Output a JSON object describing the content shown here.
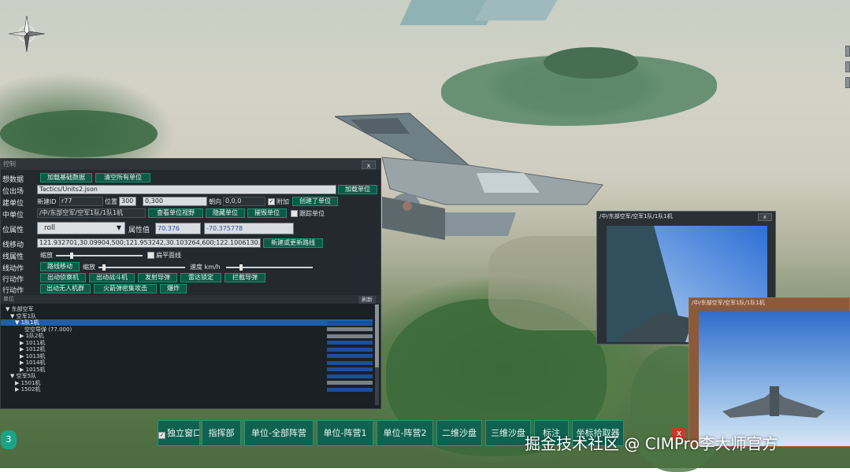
{
  "scene": {
    "compass_icon": "compass-rose-icon"
  },
  "main_panel": {
    "title": "控制",
    "close_label": "x",
    "rows": {
      "data": {
        "label": "想数据",
        "load_btn": "加载基础数据",
        "clear_btn": "清空所有单位"
      },
      "scene": {
        "label": "位出场",
        "path_value": "Tactics/Units2.json",
        "load_unit_btn": "加载单位"
      },
      "create": {
        "label": "建单位",
        "id_label": "新建ID",
        "id_value": "r77",
        "pos_label": "位置",
        "pos_value": "300",
        "pos_value2": "0,300",
        "dir_label": "朝向",
        "dir_value": "0,0,0",
        "attach_label": "附加",
        "create_btn": "创建了单位"
      },
      "select": {
        "label": "中单位",
        "path_value": "/中/东部空军/空军1队/1队1机",
        "view_btn": "查看单位视野",
        "hide_btn": "隐藏单位",
        "delete_btn": "摧毁单位",
        "track_label": "跟踪单位"
      },
      "attr": {
        "label": "位属性",
        "select_value": "roll",
        "attr_value_label": "属性值",
        "val1": "70.376",
        "val2": "-70.375778"
      },
      "move": {
        "label": "线移动",
        "coords_value": "121.932701,30.09904,500;121.953242,30.103264,600;122.1006130.",
        "move_btn": "新建或更新路线"
      },
      "props": {
        "label": "线属性",
        "slider_label": "缩放",
        "flat_label": "扁平面线"
      },
      "anim": {
        "label": "线动作",
        "patrol_btn": "路线移动",
        "zoom_label": "缩放",
        "speed_label": "速度 km/h"
      },
      "actions1": {
        "label": "行动作",
        "btn1": "出动侦察机",
        "btn2": "出动战斗机",
        "btn3": "发射导弹",
        "btn4": "雷达锁定",
        "btn5": "拦截导弹"
      },
      "actions2": {
        "label": "行动作",
        "btn1": "出动无人机群",
        "btn2": "火箭弹密集攻击",
        "btn3": "爆炸"
      }
    },
    "tree": {
      "header_left": "单位",
      "header_right": "刷新",
      "nodes": [
        {
          "text": "▼ 东部空军",
          "indent": 1
        },
        {
          "text": "▼ 空军1队",
          "indent": 2
        },
        {
          "text": "▼ 1队1机",
          "indent": 3,
          "selected": true
        },
        {
          "text": "空空导弹 (77.000)",
          "indent": 5
        },
        {
          "text": "▶ 1队2机",
          "indent": 4
        },
        {
          "text": "▶ 1011机",
          "indent": 4
        },
        {
          "text": "▶ 1012机",
          "indent": 4
        },
        {
          "text": "▶ 1013机",
          "indent": 4
        },
        {
          "text": "▶ 1014机",
          "indent": 4
        },
        {
          "text": "▶ 1015机",
          "indent": 4
        },
        {
          "text": "▼ 空军5队",
          "indent": 2
        },
        {
          "text": "▶ 1501机",
          "indent": 3
        },
        {
          "text": "▶ 1502机",
          "indent": 3
        }
      ]
    }
  },
  "cam1": {
    "title": "/中/东部空军/空军1队/1队1机",
    "close_label": "x"
  },
  "cam2": {
    "title": "/中/东部空军/空军1队/1队1机"
  },
  "toolbar": {
    "independent_label": "独立窗口",
    "buttons": [
      "指挥部",
      "单位-全部阵营",
      "单位-阵营1",
      "单位-阵营2",
      "二维沙盘",
      "三维沙盘",
      "标注",
      "坐标拾取器"
    ],
    "close_label": "x"
  },
  "badge": "3",
  "watermark": "掘金技术社区 @ CIMPro李大师官方"
}
